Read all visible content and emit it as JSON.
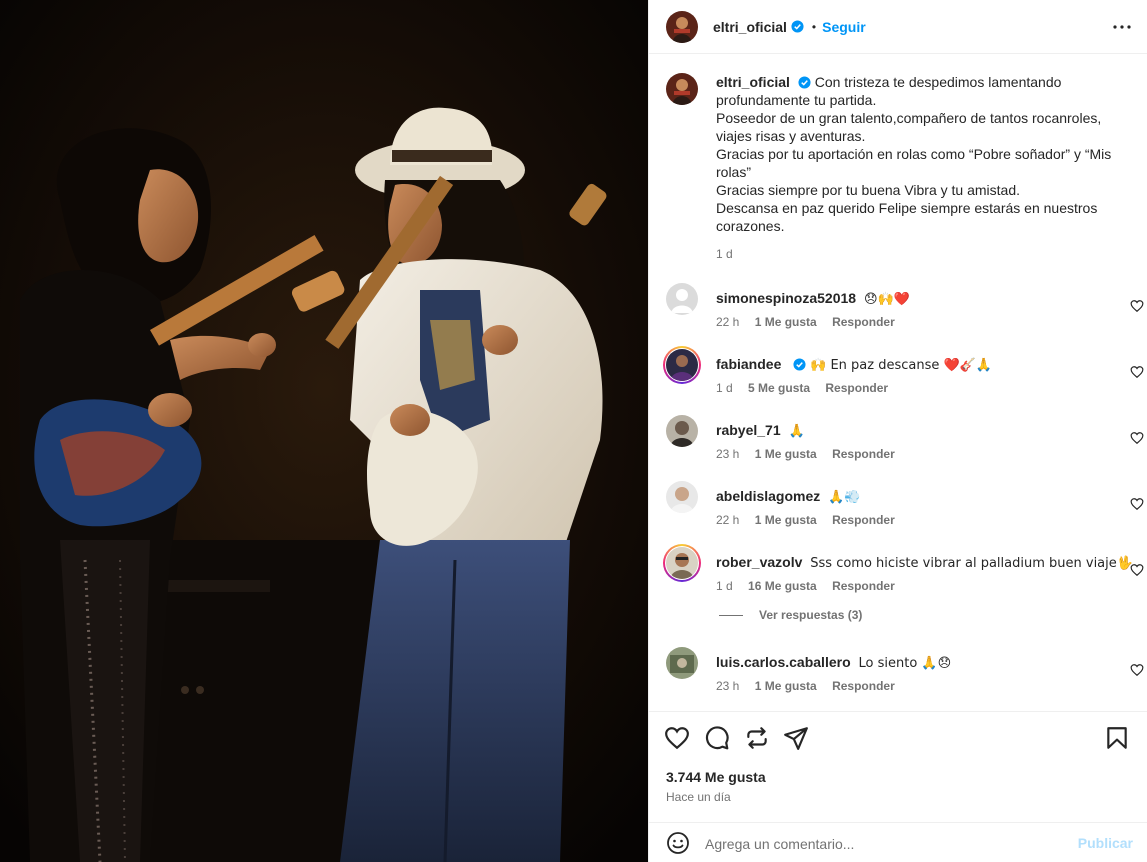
{
  "post": {
    "username": "eltri_oficial",
    "follow_label": "Seguir",
    "separator": "•",
    "photo_alt": "Dos guitarristas tocando en concierto"
  },
  "caption": {
    "username": "eltri_oficial",
    "lines": [
      "Con tristeza te despedimos lamentando profundamente tu partida.",
      "Poseedor de un gran talento,compañero de tantos rocanroles, viajes risas y aventuras.",
      "Gracias por tu aportación en rolas como “Pobre soñador” y “Mis rolas”",
      "Gracias siempre por tu buena Vibra y tu amistad.",
      "Descansa en paz querido Felipe siempre estarás en nuestros corazones."
    ],
    "time": "1 d"
  },
  "comments": [
    {
      "username": "simonespinoza52018",
      "text": "😞🙌❤️",
      "time": "22 h",
      "likes": "1 Me gusta",
      "reply": "Responder"
    },
    {
      "username": "fabiandee",
      "text": "🙌 En paz descanse ❤️🎸🙏",
      "time": "1 d",
      "likes": "5 Me gusta",
      "reply": "Responder"
    },
    {
      "username": "rabyel_71",
      "text": "🙏",
      "time": "23 h",
      "likes": "1 Me gusta",
      "reply": "Responder"
    },
    {
      "username": "abeldislagomez",
      "text": "🙏💨",
      "time": "22 h",
      "likes": "1 Me gusta",
      "reply": "Responder"
    },
    {
      "username": "rober_vazolv",
      "text": "Sss como hiciste vibrar al palladium buen viaje🖖",
      "time": "1 d",
      "likes": "16 Me gusta",
      "reply": "Responder"
    },
    {
      "username": "luis.carlos.caballero",
      "text": "Lo siento 🙏😞",
      "time": "23 h",
      "likes": "1 Me gusta",
      "reply": "Responder"
    }
  ],
  "view_replies": "Ver respuestas (3)",
  "actions": {
    "likes": "3.744 Me gusta",
    "time_ago": "Hace un día"
  },
  "add_comment": {
    "placeholder": "Agrega un comentario...",
    "publish": "Publicar"
  },
  "colors": {
    "accent": "#0095f6",
    "publish_disabled": "#b2dffc",
    "muted": "#737373",
    "text": "#262626"
  },
  "icons": [
    "verified-icon",
    "more-options-icon",
    "heart-icon",
    "comment-icon",
    "repost-icon",
    "share-icon",
    "bookmark-icon",
    "emoji-icon"
  ]
}
